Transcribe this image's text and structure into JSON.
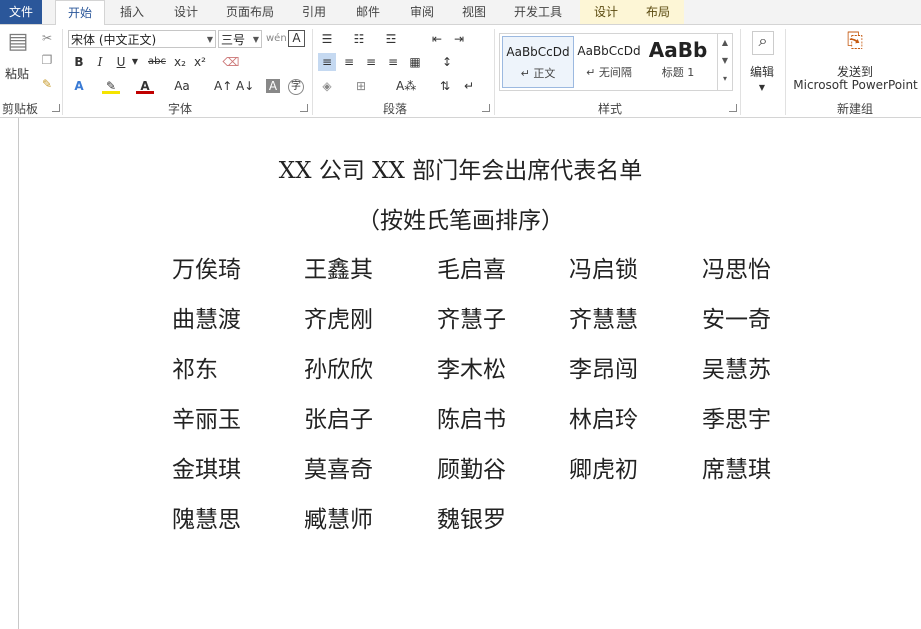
{
  "tabs": [
    {
      "label": "文件"
    },
    {
      "label": "开始"
    },
    {
      "label": "插入"
    },
    {
      "label": "设计"
    },
    {
      "label": "页面布局"
    },
    {
      "label": "引用"
    },
    {
      "label": "邮件"
    },
    {
      "label": "审阅"
    },
    {
      "label": "视图"
    },
    {
      "label": "开发工具"
    },
    {
      "label": "设计"
    },
    {
      "label": "布局"
    }
  ],
  "ribbon": {
    "clipboard": {
      "paste_label": "粘贴",
      "group_label": "剪贴板"
    },
    "font": {
      "font_name": "宋体 (中文正文)",
      "font_size": "三号",
      "group_label": "字体"
    },
    "paragraph": {
      "group_label": "段落"
    },
    "styles": {
      "items": [
        {
          "sample": "AaBbCcDd",
          "name": "↵ 正文"
        },
        {
          "sample": "AaBbCcDd",
          "name": "↵ 无间隔"
        },
        {
          "sample": "AaBb",
          "name": "标题 1"
        }
      ],
      "group_label": "样式"
    },
    "editing": {
      "label": "编辑"
    },
    "newgroup": {
      "send_label_1": "发送到",
      "send_label_2": "Microsoft PowerPoint",
      "group_label": "新建组"
    }
  },
  "document": {
    "title": "XX 公司 XX 部门年会出席代表名单",
    "subtitle": "（按姓氏笔画排序）",
    "rows": [
      [
        "万俟琦",
        "王鑫其",
        "毛启喜",
        "冯启锁",
        "冯思怡"
      ],
      [
        "曲慧渡",
        "齐虎刚",
        "齐慧子",
        "齐慧慧",
        "安一奇"
      ],
      [
        "祁东",
        "孙欣欣",
        "李木松",
        "李昂闯",
        "吴慧苏"
      ],
      [
        "辛丽玉",
        "张启子",
        "陈启书",
        "林启玲",
        "季思宇"
      ],
      [
        "金琪琪",
        "莫喜奇",
        "顾勤谷",
        "卿虎初",
        "席慧琪"
      ],
      [
        "隗慧思",
        "臧慧师",
        "魏银罗"
      ]
    ]
  }
}
